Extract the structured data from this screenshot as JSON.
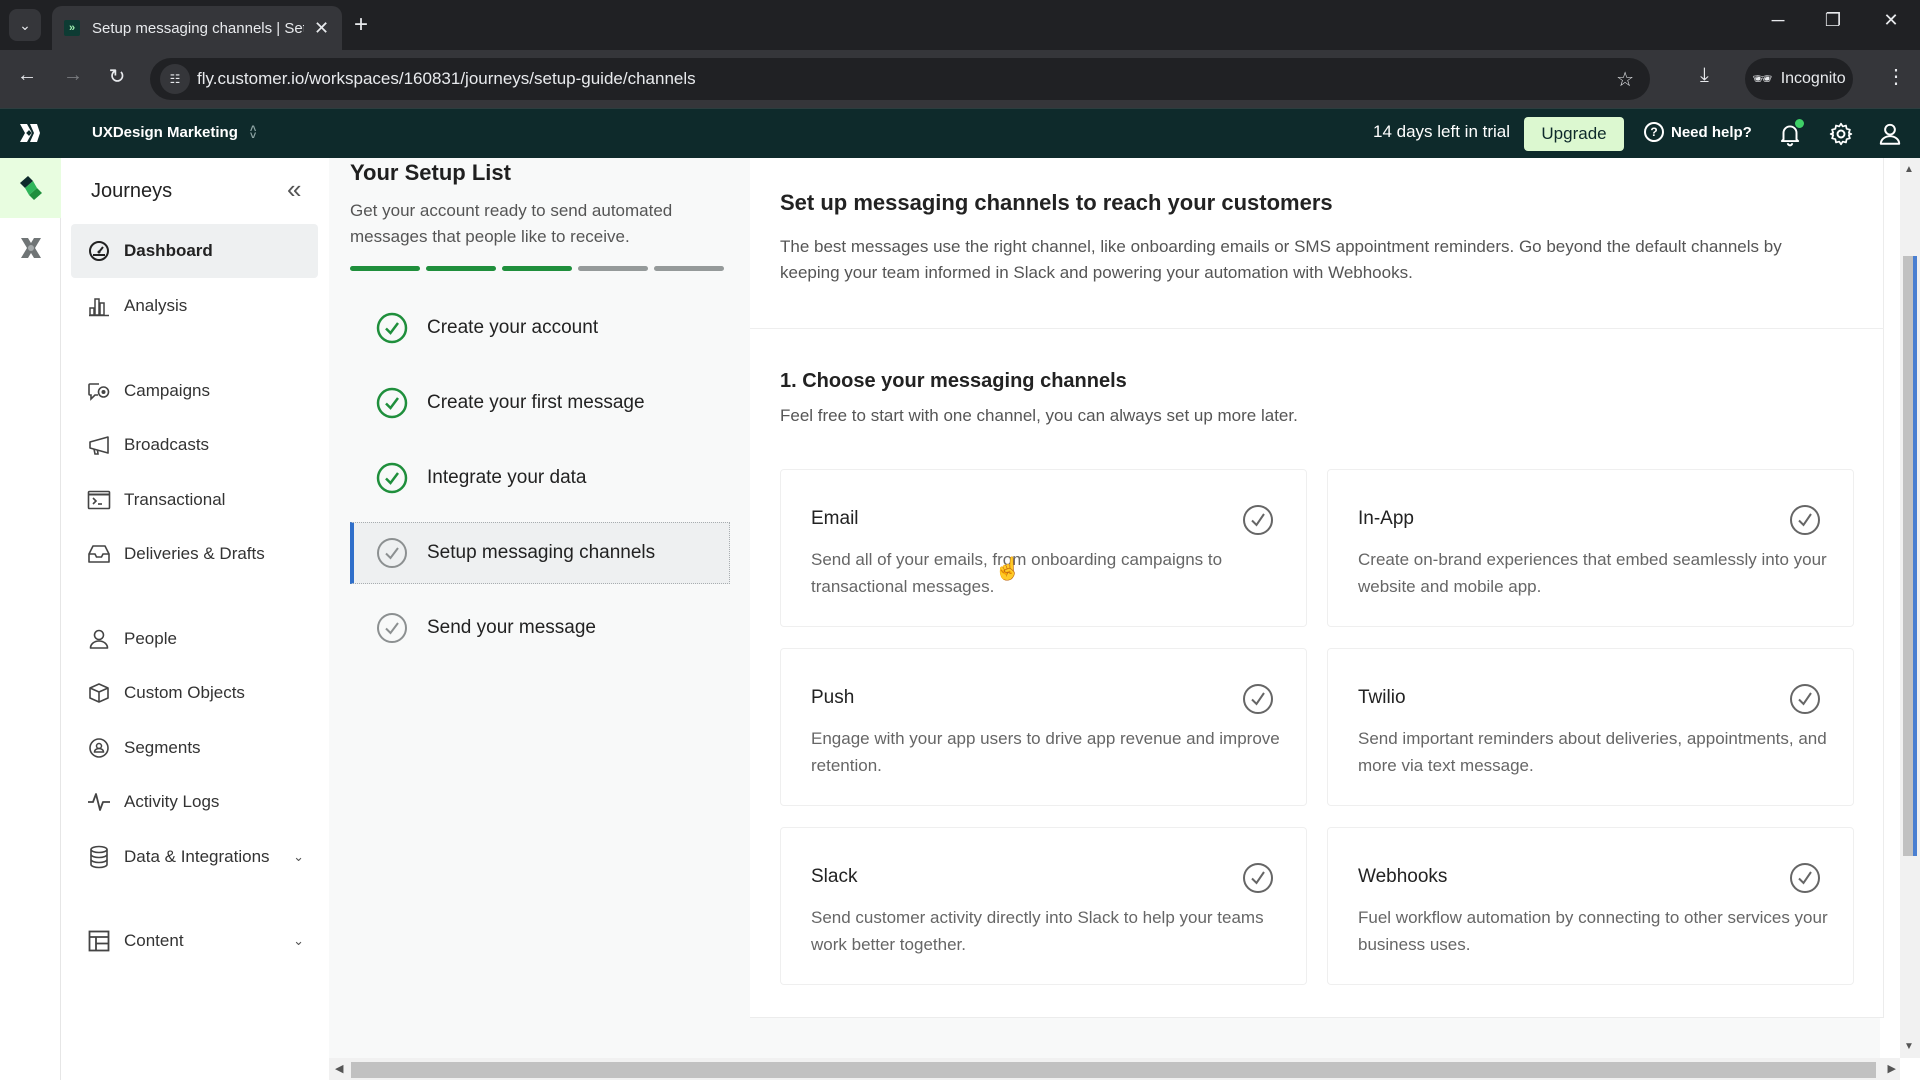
{
  "browser": {
    "tab_title": "Setup messaging channels | Set",
    "url": "fly.customer.io/workspaces/160831/journeys/setup-guide/channels",
    "incognito_label": "Incognito"
  },
  "header": {
    "workspace": "UXDesign Marketing",
    "trial_text": "14 days left in trial",
    "upgrade_label": "Upgrade",
    "help_label": "Need help?"
  },
  "sidebar": {
    "title": "Journeys",
    "items": [
      {
        "label": "Dashboard",
        "icon": "dashboard-icon",
        "active": true
      },
      {
        "label": "Analysis",
        "icon": "bar-chart-icon"
      },
      {
        "label": "Campaigns",
        "icon": "campaigns-icon"
      },
      {
        "label": "Broadcasts",
        "icon": "megaphone-icon"
      },
      {
        "label": "Transactional",
        "icon": "terminal-icon"
      },
      {
        "label": "Deliveries & Drafts",
        "icon": "inbox-icon"
      },
      {
        "label": "People",
        "icon": "person-icon"
      },
      {
        "label": "Custom Objects",
        "icon": "cube-icon"
      },
      {
        "label": "Segments",
        "icon": "segments-icon"
      },
      {
        "label": "Activity Logs",
        "icon": "pulse-icon"
      },
      {
        "label": "Data & Integrations",
        "icon": "database-icon",
        "expandable": true
      },
      {
        "label": "Content",
        "icon": "layout-icon",
        "expandable": true
      }
    ]
  },
  "setup_list": {
    "title": "Your Setup List",
    "subtitle": "Get your account ready to send automated messages that people like to receive.",
    "progress": {
      "completed": 3,
      "total": 5
    },
    "steps": [
      {
        "label": "Create your account",
        "status": "complete"
      },
      {
        "label": "Create your first message",
        "status": "complete"
      },
      {
        "label": "Integrate your data",
        "status": "complete"
      },
      {
        "label": "Setup messaging channels",
        "status": "current"
      },
      {
        "label": "Send your message",
        "status": "pending"
      }
    ]
  },
  "main": {
    "title": "Set up messaging channels to reach your customers",
    "description": "The best messages use the right channel, like onboarding emails or SMS appointment reminders. Go beyond the default channels by keeping your team informed in Slack and powering your automation with Webhooks.",
    "section_title": "1. Choose your messaging channels",
    "section_subtitle": "Feel free to start with one channel, you can always set up more later.",
    "channels": [
      {
        "name": "Email",
        "description": "Send all of your emails, from onboarding campaigns to transactional messages."
      },
      {
        "name": "In-App",
        "description": "Create on-brand experiences that embed seamlessly into your website and mobile app."
      },
      {
        "name": "Push",
        "description": "Engage with your app users to drive app revenue and improve retention."
      },
      {
        "name": "Twilio",
        "description": "Send important reminders about deliveries, appointments, and more via text message."
      },
      {
        "name": "Slack",
        "description": "Send customer activity directly into Slack to help your teams work better together."
      },
      {
        "name": "Webhooks",
        "description": "Fuel workflow automation by connecting to other services your business uses."
      }
    ]
  },
  "colors": {
    "header_bg": "#0e2a2b",
    "accent_green": "#1f8f3c",
    "upgrade_bg": "#dcf8d0",
    "current_step_border": "#2f6fca"
  }
}
